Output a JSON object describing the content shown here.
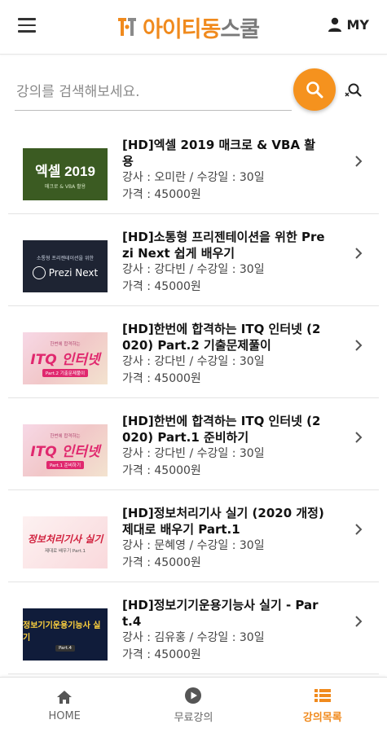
{
  "header": {
    "logo_text": "아이티동",
    "logo_text_dark": "스쿨",
    "my_label": "MY"
  },
  "search": {
    "placeholder": "강의를 검색해보세요.",
    "value": ""
  },
  "courses": [
    {
      "title": "[HD]엑셀 2019 매크로 & VBA 활용",
      "instructor": "강사 : 오미란 / 수강일 :  30일",
      "price": "가격 : 45000원",
      "thumb": {
        "style": "excel",
        "big": "엑셀 2019",
        "small": "매크로 & VBA 활용"
      }
    },
    {
      "title": "[HD]소통형 프리젠테이션을 위한 Prezi Next 쉽게 배우기",
      "instructor": "강사 : 강다빈 / 수강일 :  30일",
      "price": "가격 : 45000원",
      "thumb": {
        "style": "prezi",
        "small": "소통형 프리젠테이션을 위한",
        "brand": "Prezi Next"
      }
    },
    {
      "title": "[HD]한번에 합격하는 ITQ 인터넷 (2020) Part.2 기출문제풀이",
      "instructor": "강사 : 강다빈 / 수강일 :  30일",
      "price": "가격 : 45000원",
      "thumb": {
        "style": "itq",
        "small": "한번에 합격하는",
        "big": "ITQ 인터넷",
        "sub": "Part.2 기출문제풀이"
      }
    },
    {
      "title": "[HD]한번에 합격하는 ITQ 인터넷 (2020) Part.1 준비하기",
      "instructor": "강사 : 강다빈 / 수강일 :  30일",
      "price": "가격 : 45000원",
      "thumb": {
        "style": "itq",
        "small": "한번에 합격하는",
        "big": "ITQ 인터넷",
        "sub": "Part.1 준비하기"
      }
    },
    {
      "title": "[HD]정보처리기사 실기 (2020 개정) 제대로 배우기 Part.1",
      "instructor": "강사 : 문혜영 / 수강일 :  30일",
      "price": "가격 : 45000원",
      "thumb": {
        "style": "info",
        "big": "정보처리기사 실기",
        "sub": "제대로 배우기 Part.1"
      }
    },
    {
      "title": "[HD]정보기기운용기능사 실기 - Part.4",
      "instructor": "강사 : 김유홍 / 수강일 :  30일",
      "price": "가격 : 45000원",
      "thumb": {
        "style": "craft",
        "big": "정보기기운용기능사 실기",
        "sub": "Part.4"
      }
    }
  ],
  "tabbar": {
    "home": "HOME",
    "free": "무료강의",
    "list": "강의목록"
  },
  "colors": {
    "accent": "#f5921e",
    "brand": "#f08a1d"
  }
}
